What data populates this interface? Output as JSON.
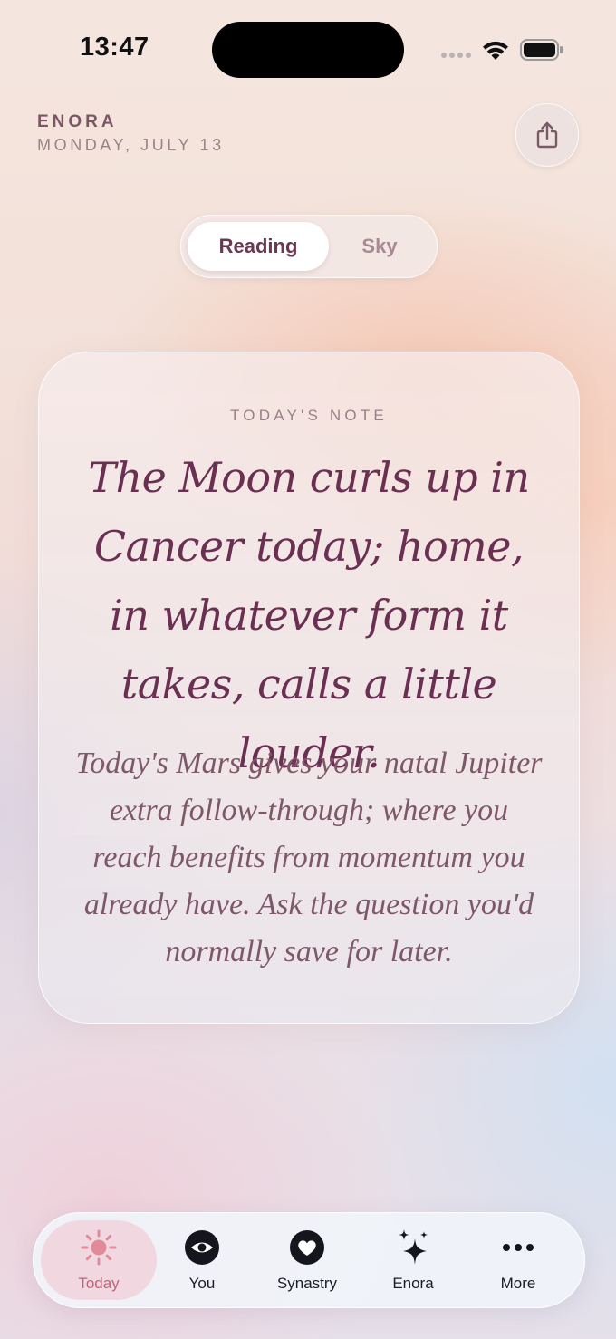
{
  "status_bar": {
    "time": "13:47"
  },
  "header": {
    "brand": "ENORA",
    "date": "MONDAY, JULY 13",
    "share_icon": "share-icon"
  },
  "segmented_control": {
    "options": [
      "Reading",
      "Sky"
    ],
    "selected": "Reading"
  },
  "note": {
    "label": "TODAY'S NOTE",
    "headline": "The Moon curls up in Cancer today; home, in whatever form it takes, calls a little louder.",
    "body": "Today's Mars gives your natal Jupiter extra follow-through; where you reach benefits from momentum you already have. Ask the question you'd normally save for later."
  },
  "tab_bar": {
    "items": [
      {
        "label": "Today",
        "icon": "sun-icon",
        "selected": true
      },
      {
        "label": "You",
        "icon": "eye-icon",
        "selected": false
      },
      {
        "label": "Synastry",
        "icon": "heart-icon",
        "selected": false
      },
      {
        "label": "Enora",
        "icon": "sparkles-icon",
        "selected": false
      },
      {
        "label": "More",
        "icon": "ellipsis-icon",
        "selected": false
      }
    ]
  },
  "colors": {
    "accent": "#c0627c",
    "headline": "#6b2f52",
    "body_text": "#7e5869"
  }
}
